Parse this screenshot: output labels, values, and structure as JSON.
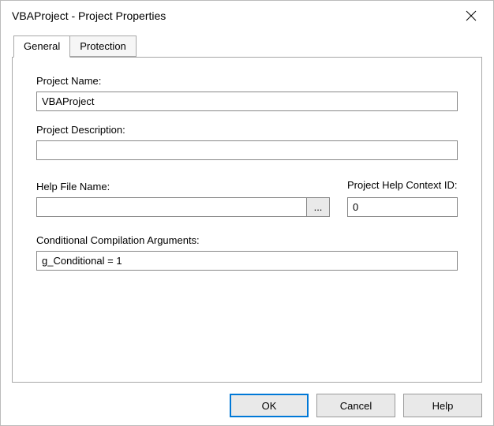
{
  "window": {
    "title": "VBAProject - Project Properties"
  },
  "tabs": [
    {
      "label": "General",
      "active": true
    },
    {
      "label": "Protection",
      "active": false
    }
  ],
  "fields": {
    "project_name": {
      "label": "Project Name:",
      "value": "VBAProject"
    },
    "project_description": {
      "label": "Project Description:",
      "value": ""
    },
    "help_file": {
      "label": "Help File Name:",
      "value": "",
      "browse_label": "..."
    },
    "context_id": {
      "label": "Project Help Context ID:",
      "value": "0"
    },
    "cond_args": {
      "label": "Conditional Compilation Arguments:",
      "value": "g_Conditional = 1"
    }
  },
  "buttons": {
    "ok": "OK",
    "cancel": "Cancel",
    "help": "Help"
  }
}
